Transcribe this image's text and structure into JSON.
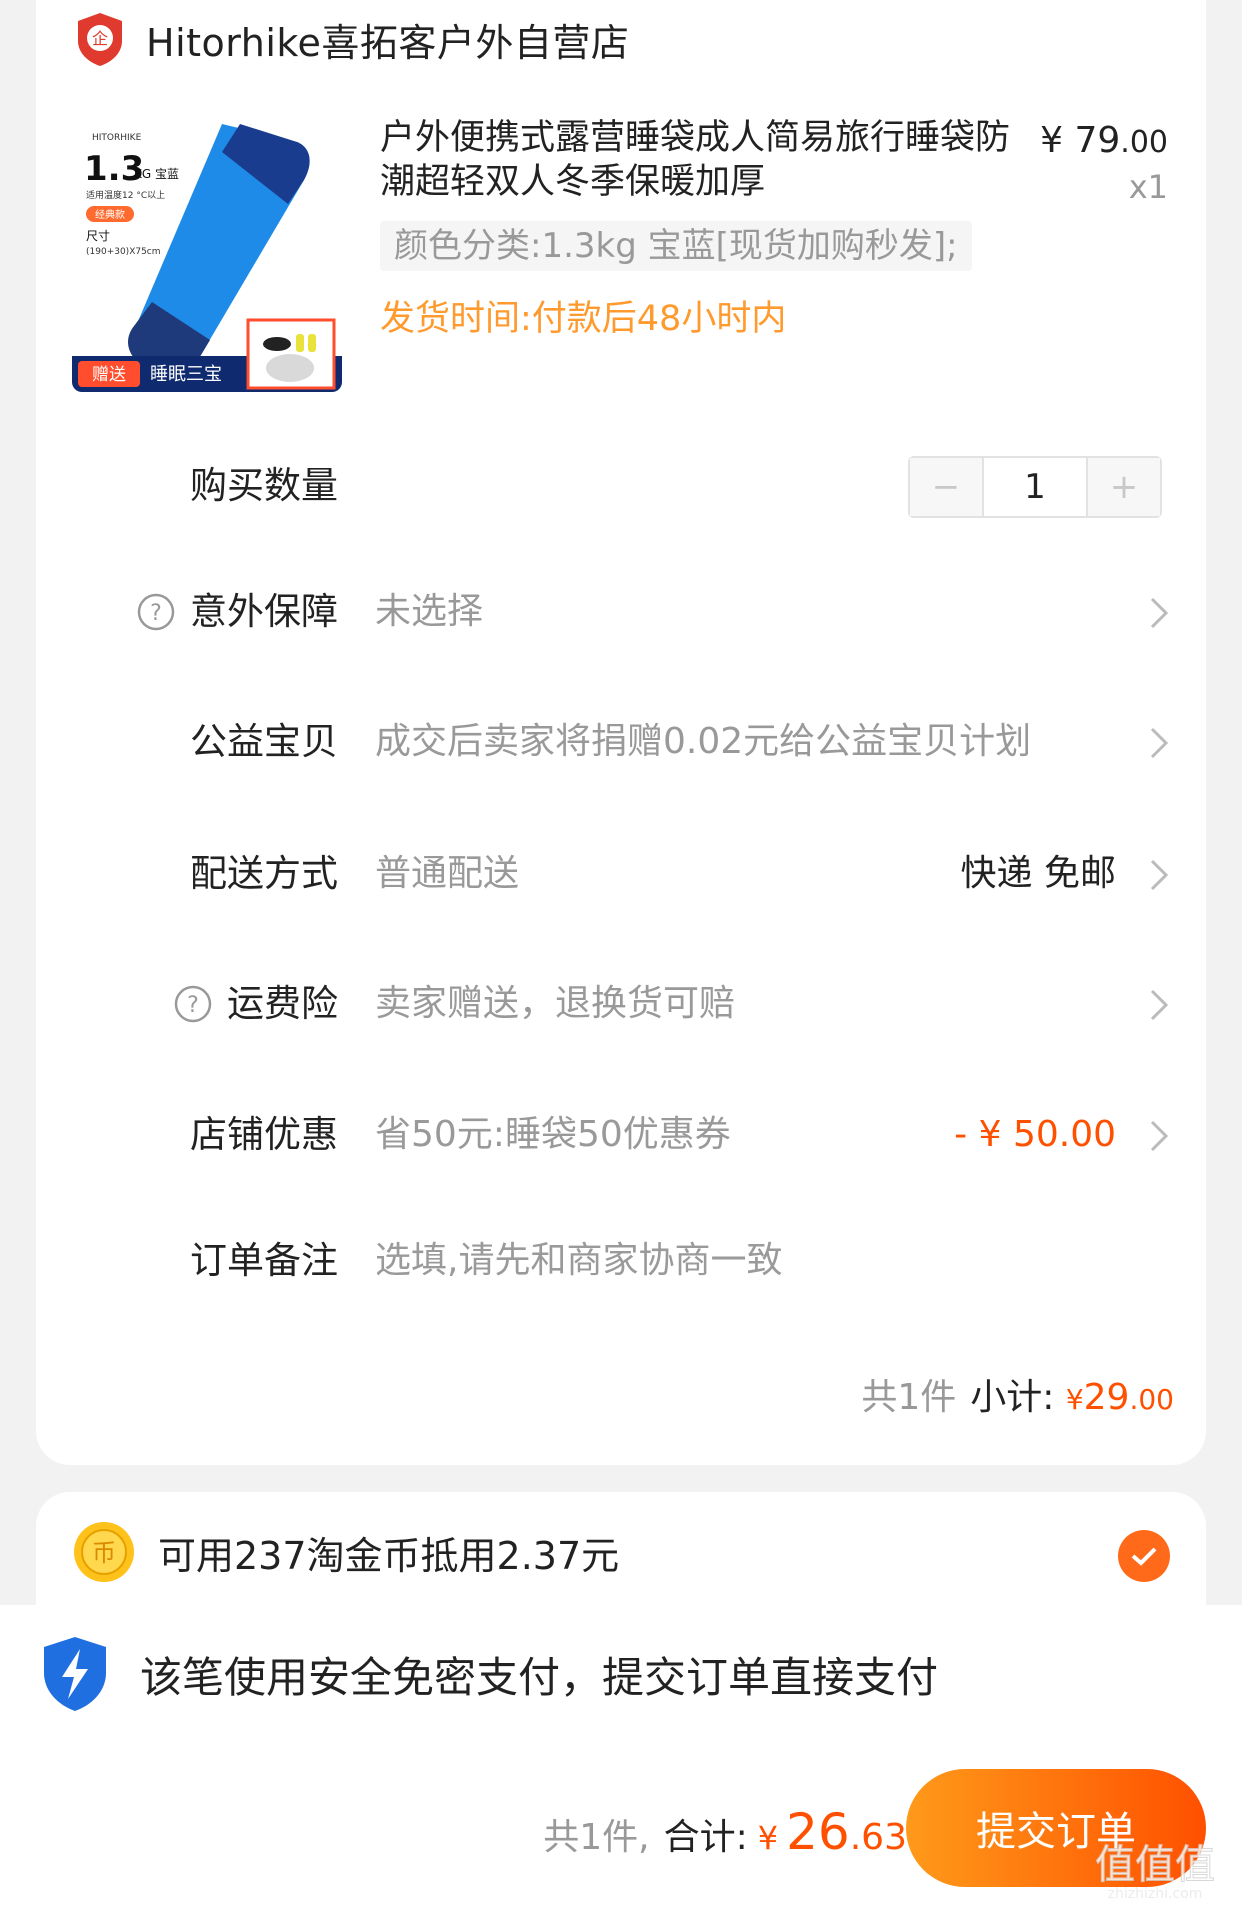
{
  "shop": {
    "name": "Hitorhike喜拓客户外自营店",
    "badge_icon": "enterprise-shield-icon"
  },
  "product": {
    "image": {
      "brand": "HITORHIKE",
      "weight": "1.3",
      "weight_unit": "KG 宝蓝",
      "temp": "适用温度12 °C以上",
      "tag": "经典款",
      "size_label": "尺寸",
      "size_value": "(190+30)X75cm",
      "promo_badge": "赠送",
      "promo_text": "睡眠三宝"
    },
    "title": "户外便携式露营睡袋成人简易旅行睡袋防潮超轻双人冬季保暖加厚",
    "price_yen": "¥",
    "price_int": "79",
    "price_cents": ".00",
    "quantity_label": "x1",
    "sku": "颜色分类:1.3kg 宝蓝[现货加购秒发];",
    "ship_time": "发货时间:付款后48小时内"
  },
  "rows": {
    "quantity": {
      "label": "购买数量",
      "value": "1",
      "minus": "−",
      "plus": "+"
    },
    "insurance": {
      "label": "意外保障",
      "value": "未选择"
    },
    "charity": {
      "label": "公益宝贝",
      "value": "成交后卖家将捐赠0.02元给公益宝贝计划"
    },
    "delivery": {
      "label": "配送方式",
      "value": "普通配送",
      "right": "快递 免邮"
    },
    "freight": {
      "label": "运费险",
      "value": "卖家赠送，退换货可赔"
    },
    "discount": {
      "label": "店铺优惠",
      "value": "省50元:睡袋50优惠券",
      "right": "- ¥ 50.00"
    },
    "note": {
      "label": "订单备注",
      "placeholder": "选填,请先和商家协商一致"
    }
  },
  "subtotal": {
    "count": "共1件",
    "label": "小计:",
    "yen": "¥",
    "int": "29",
    "cents": ".00"
  },
  "coins": {
    "text": "可用237淘金币抵用2.37元",
    "checked": true
  },
  "payment": {
    "secure_text": "该笔使用安全免密支付，提交订单直接支付",
    "count": "共1件,",
    "total_label": "合计:",
    "yen": "¥",
    "total_int": "26",
    "total_cents": ".63",
    "submit_label": "提交订单"
  },
  "watermark": {
    "text": "值值值",
    "domain": "zhizhizhi.com"
  },
  "colors": {
    "accent": "#ff5000",
    "ship_time": "#ff9a2e",
    "product_blue": "#1f8be8"
  }
}
